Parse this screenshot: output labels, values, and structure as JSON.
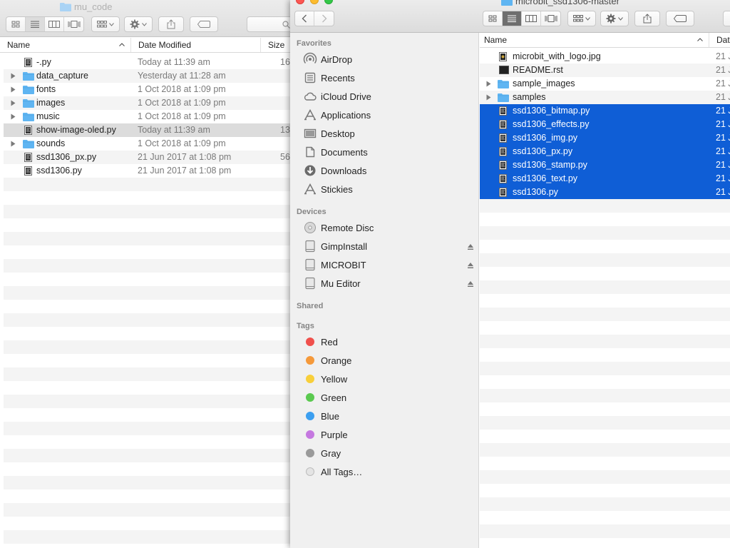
{
  "back_window": {
    "title": "mu_code",
    "columns": {
      "name": "Name",
      "date": "Date Modified",
      "size": "Size"
    },
    "rows": [
      {
        "name": "-.py",
        "date": "Today at 11:39 am",
        "size": "16",
        "type": "file",
        "expandable": false
      },
      {
        "name": "data_capture",
        "date": "Yesterday at 11:28 am",
        "size": "",
        "type": "folder",
        "expandable": true
      },
      {
        "name": "fonts",
        "date": "1 Oct 2018 at 1:09 pm",
        "size": "",
        "type": "folder",
        "expandable": true
      },
      {
        "name": "images",
        "date": "1 Oct 2018 at 1:09 pm",
        "size": "",
        "type": "folder",
        "expandable": true
      },
      {
        "name": "music",
        "date": "1 Oct 2018 at 1:09 pm",
        "size": "",
        "type": "folder",
        "expandable": true
      },
      {
        "name": "show-image-oled.py",
        "date": "Today at 11:39 am",
        "size": "13",
        "type": "file",
        "expandable": false,
        "highlighted": true
      },
      {
        "name": "sounds",
        "date": "1 Oct 2018 at 1:09 pm",
        "size": "",
        "type": "folder",
        "expandable": true
      },
      {
        "name": "ssd1306_px.py",
        "date": "21 Jun 2017 at 1:08 pm",
        "size": "56",
        "type": "file",
        "expandable": false
      },
      {
        "name": "ssd1306.py",
        "date": "21 Jun 2017 at 1:08 pm",
        "size": "",
        "type": "file",
        "expandable": false
      }
    ]
  },
  "front_window": {
    "title": "microbit_ssd1306-master",
    "sidebar": {
      "favorites_heading": "Favorites",
      "favorites": [
        {
          "label": "AirDrop",
          "icon": "airdrop-icon"
        },
        {
          "label": "Recents",
          "icon": "recents-icon"
        },
        {
          "label": "iCloud Drive",
          "icon": "cloud-icon"
        },
        {
          "label": "Applications",
          "icon": "applications-icon"
        },
        {
          "label": "Desktop",
          "icon": "desktop-icon"
        },
        {
          "label": "Documents",
          "icon": "documents-icon"
        },
        {
          "label": "Downloads",
          "icon": "downloads-icon"
        },
        {
          "label": "Stickies",
          "icon": "applications-icon"
        }
      ],
      "devices_heading": "Devices",
      "devices": [
        {
          "label": "Remote Disc",
          "icon": "disc-icon",
          "eject": false
        },
        {
          "label": "GimpInstall",
          "icon": "drive-icon",
          "eject": true
        },
        {
          "label": "MICROBIT",
          "icon": "drive-icon",
          "eject": true
        },
        {
          "label": "Mu Editor",
          "icon": "drive-icon",
          "eject": true
        }
      ],
      "shared_heading": "Shared",
      "tags_heading": "Tags",
      "tags": [
        {
          "label": "Red",
          "color": "#f0504c"
        },
        {
          "label": "Orange",
          "color": "#f5993a"
        },
        {
          "label": "Yellow",
          "color": "#f8cf3a"
        },
        {
          "label": "Green",
          "color": "#5ac94f"
        },
        {
          "label": "Blue",
          "color": "#3c9ff0"
        },
        {
          "label": "Purple",
          "color": "#c578e0"
        },
        {
          "label": "Gray",
          "color": "#9a9a9a"
        },
        {
          "label": "All Tags…",
          "color": "#e4e4e4"
        }
      ]
    },
    "columns": {
      "name": "Name",
      "date": "Dat"
    },
    "rows": [
      {
        "name": "microbit_with_logo.jpg",
        "date": "21 J",
        "type": "image",
        "expandable": false,
        "selected": false
      },
      {
        "name": "README.rst",
        "date": "21 J",
        "type": "doc",
        "expandable": false,
        "selected": false
      },
      {
        "name": "sample_images",
        "date": "21 J",
        "type": "folder",
        "expandable": true,
        "selected": false
      },
      {
        "name": "samples",
        "date": "21 J",
        "type": "folder",
        "expandable": true,
        "selected": false
      },
      {
        "name": "ssd1306_bitmap.py",
        "date": "21 J",
        "type": "file",
        "expandable": false,
        "selected": true
      },
      {
        "name": "ssd1306_effects.py",
        "date": "21 J",
        "type": "file",
        "expandable": false,
        "selected": true
      },
      {
        "name": "ssd1306_img.py",
        "date": "21 J",
        "type": "file",
        "expandable": false,
        "selected": true
      },
      {
        "name": "ssd1306_px.py",
        "date": "21 J",
        "type": "file",
        "expandable": false,
        "selected": true
      },
      {
        "name": "ssd1306_stamp.py",
        "date": "21 J",
        "type": "file",
        "expandable": false,
        "selected": true
      },
      {
        "name": "ssd1306_text.py",
        "date": "21 J",
        "type": "file",
        "expandable": false,
        "selected": true
      },
      {
        "name": "ssd1306.py",
        "date": "21 J",
        "type": "file",
        "expandable": false,
        "selected": true
      }
    ]
  },
  "colors": {
    "selection": "#0f5ed6",
    "folder": "#5fb5f2",
    "stripe": "#f4f4f4"
  }
}
